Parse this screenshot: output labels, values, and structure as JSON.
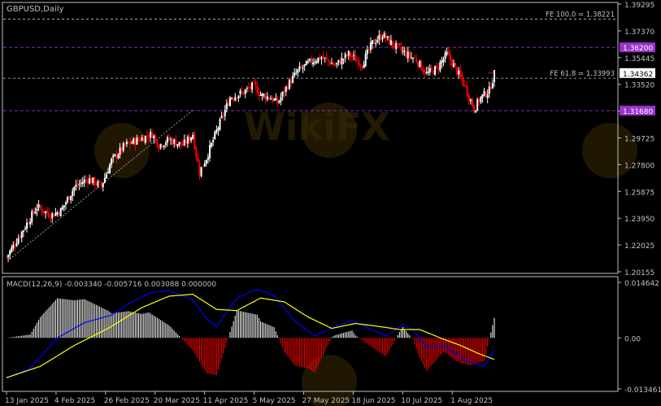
{
  "colors": {
    "background": "#000000",
    "frame": "#c0c0c0",
    "bull_candle": "#ffffff",
    "bear_candle": "#ff0000",
    "text": "#c0c0c0",
    "level_line": "#c0c0c0",
    "purple_level": "#9932cc",
    "macd_hist_pos": "#ffffff",
    "macd_hist_neg": "#ff0000",
    "macd_line": "#0000ff",
    "signal_line": "#ffff00",
    "watermark": "#3a2a05"
  },
  "price_panel": {
    "title": "GBPUSD,Daily",
    "ylim": [
      1.20155,
      1.39295
    ],
    "y_ticks": [
      "1.39295",
      "1.37370",
      "1.35445",
      "1.33520",
      "1.31595",
      "1.29725",
      "1.27800",
      "1.25875",
      "1.23950",
      "1.22025",
      "1.20155"
    ],
    "levels": [
      {
        "label": "FE 100.0 = 1.38221",
        "value": 1.38221,
        "style": "fib"
      },
      {
        "label": "1.36200",
        "value": 1.362,
        "style": "purple"
      },
      {
        "label": "FE 61.8 = 1.33993",
        "value": 1.33993,
        "style": "fib"
      },
      {
        "label": "1.34362",
        "value": 1.34362,
        "style": "current"
      },
      {
        "label": "1.31680",
        "value": 1.3168,
        "style": "purple"
      }
    ]
  },
  "macd_panel": {
    "title": "MACD(12,26,9) -0.003340 -0.005716 0.003088 0.000000",
    "ylim": [
      -0.013461,
      0.014642
    ],
    "y_ticks": [
      "0.014642",
      "0.00",
      "-0.013461"
    ]
  },
  "x_axis": {
    "labels": [
      "13 Jan 2025",
      "4 Feb 2025",
      "26 Feb 2025",
      "20 Mar 2025",
      "11 Apr 2025",
      "5 May 2025",
      "27 May 2025",
      "18 Jun 2025",
      "10 Jul 2025",
      "1 Aug 2025"
    ]
  },
  "watermark": {
    "text": "WikiFX"
  },
  "chart_data": {
    "type": "candlestick",
    "symbol": "GBPUSD",
    "timeframe": "Daily",
    "close_path": [
      [
        0,
        1.212
      ],
      [
        10,
        1.232
      ],
      [
        18,
        1.248
      ],
      [
        26,
        1.242
      ],
      [
        32,
        1.245
      ],
      [
        40,
        1.262
      ],
      [
        48,
        1.268
      ],
      [
        56,
        1.263
      ],
      [
        62,
        1.281
      ],
      [
        70,
        1.292
      ],
      [
        78,
        1.296
      ],
      [
        86,
        1.3
      ],
      [
        90,
        1.292
      ],
      [
        96,
        1.296
      ],
      [
        104,
        1.292
      ],
      [
        108,
        1.297
      ],
      [
        110,
        1.3
      ],
      [
        112,
        1.285
      ],
      [
        114,
        1.273
      ],
      [
        118,
        1.283
      ],
      [
        124,
        1.302
      ],
      [
        132,
        1.326
      ],
      [
        140,
        1.33
      ],
      [
        146,
        1.335
      ],
      [
        150,
        1.328
      ],
      [
        156,
        1.326
      ],
      [
        160,
        1.322
      ],
      [
        166,
        1.335
      ],
      [
        172,
        1.345
      ],
      [
        180,
        1.352
      ],
      [
        186,
        1.355
      ],
      [
        194,
        1.349
      ],
      [
        202,
        1.357
      ],
      [
        210,
        1.35
      ],
      [
        216,
        1.365
      ],
      [
        222,
        1.371
      ],
      [
        228,
        1.364
      ],
      [
        236,
        1.357
      ],
      [
        242,
        1.353
      ],
      [
        248,
        1.343
      ],
      [
        254,
        1.347
      ],
      [
        260,
        1.357
      ],
      [
        264,
        1.349
      ],
      [
        270,
        1.336
      ],
      [
        276,
        1.318
      ],
      [
        280,
        1.326
      ],
      [
        285,
        1.331
      ],
      [
        288,
        1.343
      ]
    ],
    "macd_path": [
      [
        0,
        -0.0105
      ],
      [
        14,
        -0.008
      ],
      [
        30,
        0.0
      ],
      [
        46,
        0.004
      ],
      [
        62,
        0.006
      ],
      [
        72,
        0.009
      ],
      [
        84,
        0.0118
      ],
      [
        96,
        0.0125
      ],
      [
        110,
        0.01
      ],
      [
        118,
        0.005
      ],
      [
        124,
        0.003
      ],
      [
        136,
        0.0105
      ],
      [
        148,
        0.0128
      ],
      [
        158,
        0.0112
      ],
      [
        170,
        0.0045
      ],
      [
        182,
        0.0005
      ],
      [
        194,
        0.003
      ],
      [
        204,
        0.0045
      ],
      [
        214,
        0.0025
      ],
      [
        224,
        0.0005
      ],
      [
        234,
        0.0035
      ],
      [
        240,
        0.002
      ],
      [
        248,
        -0.0025
      ],
      [
        258,
        -0.002
      ],
      [
        266,
        -0.0045
      ],
      [
        274,
        -0.0065
      ],
      [
        282,
        -0.0075
      ],
      [
        288,
        -0.0033
      ]
    ],
    "signal_path": [
      [
        0,
        -0.0105
      ],
      [
        20,
        -0.0075
      ],
      [
        40,
        -0.002
      ],
      [
        60,
        0.0025
      ],
      [
        80,
        0.008
      ],
      [
        96,
        0.011
      ],
      [
        110,
        0.0115
      ],
      [
        124,
        0.0075
      ],
      [
        136,
        0.0072
      ],
      [
        150,
        0.0105
      ],
      [
        164,
        0.0095
      ],
      [
        178,
        0.0055
      ],
      [
        192,
        0.0025
      ],
      [
        206,
        0.0038
      ],
      [
        220,
        0.003
      ],
      [
        232,
        0.0022
      ],
      [
        244,
        0.0022
      ],
      [
        256,
        0.0
      ],
      [
        268,
        -0.002
      ],
      [
        278,
        -0.004
      ],
      [
        288,
        -0.0057
      ]
    ]
  }
}
